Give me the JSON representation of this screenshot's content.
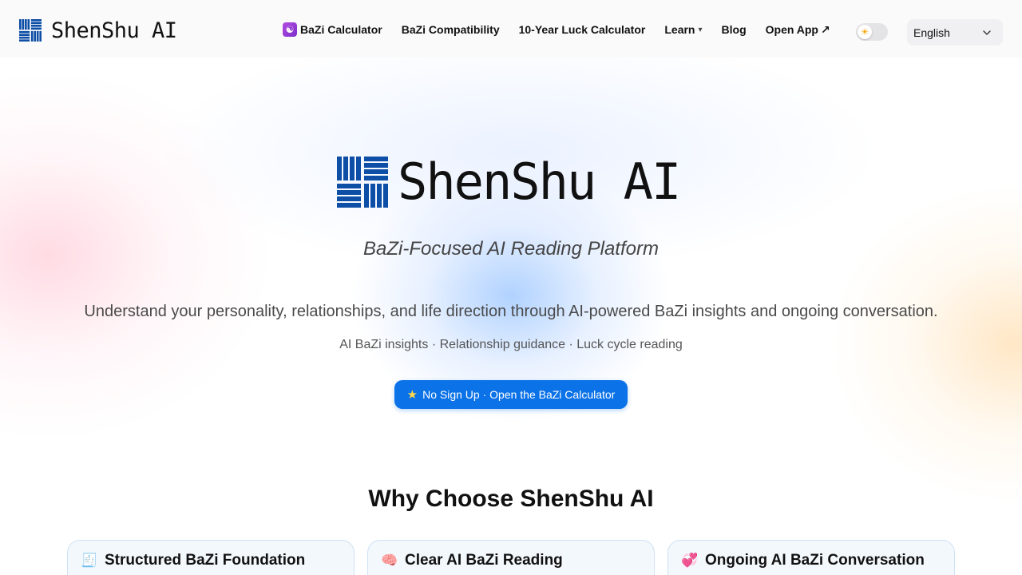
{
  "brand": {
    "name": "ShenShu AI"
  },
  "nav": {
    "items": [
      {
        "label": "BaZi Calculator",
        "icon": "yin-yang-icon"
      },
      {
        "label": "BaZi Compatibility"
      },
      {
        "label": "10-Year Luck Calculator"
      },
      {
        "label": "Learn",
        "has_dropdown": true,
        "caret": "▾"
      },
      {
        "label": "Blog"
      },
      {
        "label": "Open App",
        "suffix": "↗"
      }
    ],
    "theme_toggle": {
      "icon": "sun-icon",
      "glyph": "☀"
    },
    "language": {
      "selected": "English"
    }
  },
  "hero": {
    "title": "ShenShu AI",
    "subtitle": "BaZi-Focused AI Reading Platform",
    "description": "Understand your personality, relationships, and life direction through AI-powered BaZi insights and ongoing conversation.",
    "features": "AI BaZi insights · Relationship guidance · Luck cycle reading",
    "cta": {
      "icon": "star-icon",
      "glyph": "★",
      "label": "No Sign Up · Open the BaZi Calculator"
    }
  },
  "why": {
    "title": "Why Choose ShenShu AI",
    "cards": [
      {
        "icon": "receipt-icon",
        "glyph": "🧾",
        "title": "Structured BaZi Foundation"
      },
      {
        "icon": "brain-icon",
        "glyph": "🧠",
        "title": "Clear AI BaZi Reading"
      },
      {
        "icon": "hearts-icon",
        "glyph": "💞",
        "title": "Ongoing AI BaZi Conversation"
      }
    ]
  },
  "colors": {
    "brand_blue": "#0d4ea6",
    "cta_blue": "#0b72e7"
  }
}
